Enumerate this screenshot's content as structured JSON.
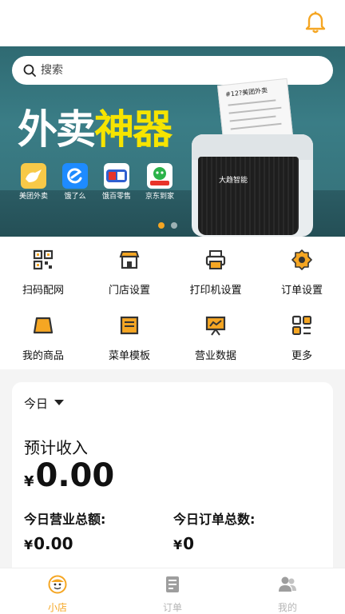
{
  "header": {
    "notification_icon": "bell-icon"
  },
  "banner": {
    "search_placeholder": "搜索",
    "headline_white": "外卖",
    "headline_yellow": "神器",
    "platforms": [
      {
        "name": "美团外卖",
        "color": "#f7c948"
      },
      {
        "name": "饿了么",
        "color": "#1e8bff"
      },
      {
        "name": "饿百零售",
        "color": "#ffffff"
      },
      {
        "name": "京东到家",
        "color": "#ffffff"
      }
    ],
    "receipt_title": "#12?美团外卖",
    "printer_brand": "大趋智能",
    "carousel_active_index": 0
  },
  "menu": {
    "items": [
      {
        "label": "扫码配网",
        "icon": "qr-scan-icon"
      },
      {
        "label": "门店设置",
        "icon": "store-icon"
      },
      {
        "label": "打印机设置",
        "icon": "printer-icon"
      },
      {
        "label": "订单设置",
        "icon": "gear-icon"
      },
      {
        "label": "我的商品",
        "icon": "goods-icon"
      },
      {
        "label": "菜单模板",
        "icon": "menu-template-icon"
      },
      {
        "label": "营业数据",
        "icon": "chart-board-icon"
      },
      {
        "label": "更多",
        "icon": "more-grid-icon"
      }
    ]
  },
  "stats": {
    "period": "今日",
    "estimated_income_label": "预计收入",
    "currency": "¥",
    "estimated_income_value": "0.00",
    "total_sales_label": "今日营业总额:",
    "total_sales_value": "0.00",
    "total_orders_label": "今日订单总数:",
    "total_orders_value": "0"
  },
  "tabbar": {
    "tabs": [
      {
        "label": "小店",
        "active": true
      },
      {
        "label": "订单",
        "active": false
      },
      {
        "label": "我的",
        "active": false
      }
    ]
  },
  "colors": {
    "accent": "#f5a623",
    "icon_dark": "#333333",
    "inactive": "#b5b5b5"
  }
}
